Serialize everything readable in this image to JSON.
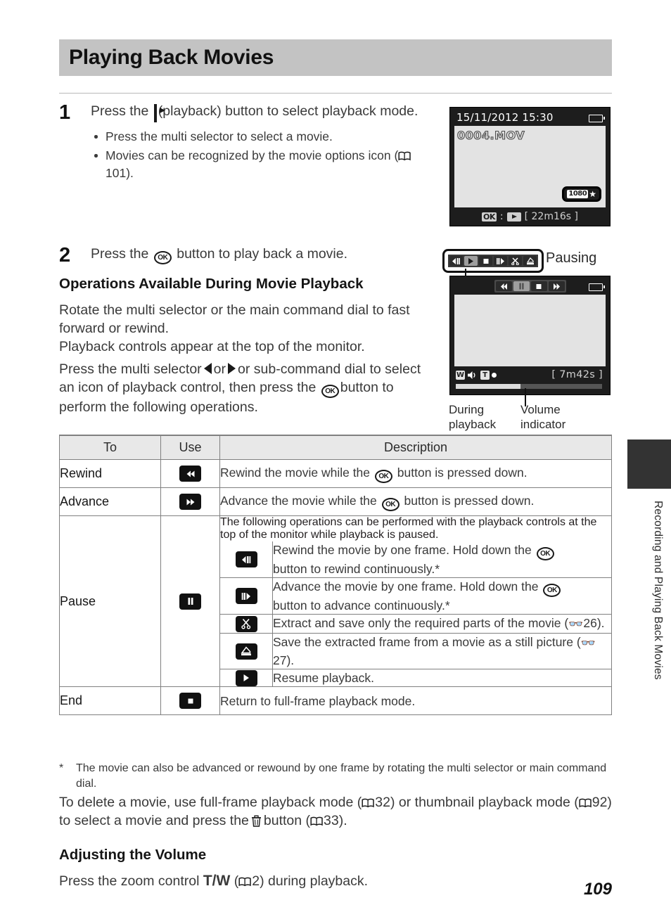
{
  "page": {
    "title": "Playing Back Movies",
    "number": "109",
    "side_tab_label": "Recording and Playing Back Movies"
  },
  "step1": {
    "number": "1",
    "text_before_icon": "Press the",
    "icon": "playback-button-icon",
    "text_after_icon": "(playback) button to select playback mode.",
    "bullets": [
      {
        "text": "Press the multi selector to select a movie."
      },
      {
        "text_a": "Movies can be recognized by the movie options icon (",
        "ref": "101",
        "text_b": ")."
      }
    ]
  },
  "step2": {
    "number": "2",
    "text_before_icon": "Press the",
    "icon": "ok-button-icon",
    "text_after_icon": "button to play back a movie."
  },
  "section": {
    "heading": "Operations Available During Movie Playback",
    "para1": "Rotate the multi selector or the main command dial to fast forward or rewind.",
    "para2": "Playback controls appear at the top of the monitor.",
    "para3_a": "Press the multi selector",
    "para3_or": "or",
    "para3_b": "or sub-command dial to select an icon of playback control, then press the",
    "para3_c": "button to perform the following operations."
  },
  "lcd1": {
    "datetime": "15/11/2012  15:30",
    "filename": "0004.MOV",
    "movie_option_badge": "1080",
    "ok_label": "OK",
    "separator": ":",
    "duration": "[  22m16s ]"
  },
  "lcd2": {
    "pausing_label": "Pausing",
    "callout_keys": [
      {
        "name": "frame-rewind-icon",
        "selected": false
      },
      {
        "name": "play-icon",
        "selected": true
      },
      {
        "name": "stop-icon",
        "selected": false
      },
      {
        "name": "frame-advance-icon",
        "selected": false
      },
      {
        "name": "scissors-icon",
        "selected": false
      },
      {
        "name": "save-frame-icon",
        "selected": false
      }
    ],
    "top_keys": [
      {
        "name": "rewind-icon",
        "selected": false
      },
      {
        "name": "pause-icon",
        "selected": true
      },
      {
        "name": "stop-icon",
        "selected": false
      },
      {
        "name": "advance-icon",
        "selected": false
      }
    ],
    "wide_label": "W",
    "tele_label": "T",
    "duration": "[    7m42s ]",
    "caption_during_playback": "During\nplayback",
    "caption_volume_indicator": "Volume\nindicator"
  },
  "table": {
    "headers": {
      "to": "To",
      "use": "Use",
      "description": "Description"
    },
    "rows": [
      {
        "to": "Rewind",
        "icon": "rewind-icon",
        "desc_a": "Rewind the movie while the",
        "desc_b": "button is pressed down."
      },
      {
        "to": "Advance",
        "icon": "advance-icon",
        "desc_a": "Advance the movie while the",
        "desc_b": "button is pressed down."
      }
    ],
    "pause_row": {
      "to": "Pause",
      "icon": "pause-icon",
      "intro": "The following operations can be performed with the playback controls at the top of the monitor while playback is paused.",
      "subrows": [
        {
          "icon": "frame-rewind-icon",
          "desc_a": "Rewind the movie by one frame. Hold down the",
          "desc_b": "button to rewind continuously.*"
        },
        {
          "icon": "frame-advance-icon",
          "desc_a": "Advance the movie by one frame. Hold down the",
          "desc_b": "button to advance continuously.*"
        },
        {
          "icon": "scissors-icon",
          "desc_a": "Extract and save only the required parts of the movie (",
          "ref": "26",
          "desc_b": ")."
        },
        {
          "icon": "save-frame-icon",
          "desc_a": "Save the extracted frame from a movie as a still picture (",
          "ref": "27",
          "desc_b": ")."
        },
        {
          "icon": "play-icon",
          "desc_a": "Resume playback.",
          "desc_b": ""
        }
      ]
    },
    "end_row": {
      "to": "End",
      "icon": "stop-icon",
      "desc": "Return to full-frame playback mode."
    }
  },
  "footnote": {
    "marker": "*",
    "text": "The movie can also be advanced or rewound by one frame by rotating the multi selector or main command dial."
  },
  "closing": {
    "a": "To delete a movie, use full-frame playback mode (",
    "ref1": "32",
    "b": ") or thumbnail playback mode (",
    "ref2": "92",
    "c": ") to select a movie and press the",
    "d": "button (",
    "ref3": "33",
    "e": ")."
  },
  "volume_section": {
    "heading": "Adjusting the Volume",
    "text_a": "Press the zoom control",
    "tw": "T/W",
    "text_b": "(",
    "ref": "2",
    "text_c": ") during playback."
  }
}
